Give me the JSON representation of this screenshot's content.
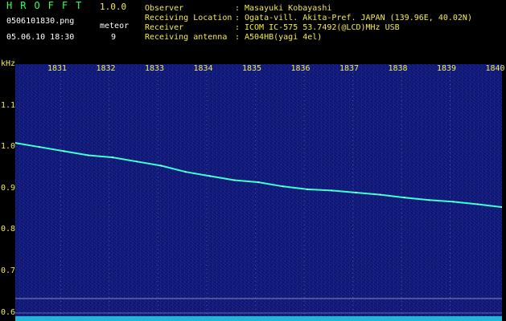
{
  "header": {
    "app_title": "HROFFT",
    "app_version": "1.0.0",
    "file_name": "0506101830.png",
    "meteor_label": "meteor",
    "timestamp": "05.06.10 18:30",
    "meteor_count": "9"
  },
  "info": {
    "rows": [
      {
        "key": "Observer",
        "value": "Masayuki Kobayashi"
      },
      {
        "key": "Receiving Location",
        "value": "Ogata-vill. Akita-Pref. JAPAN (139.96E, 40.02N)"
      },
      {
        "key": "Receiver",
        "value": "ICOM IC-575 53.7492(@LCD)MHz USB"
      },
      {
        "key": "Receiving antenna",
        "value": "A504HB(yagi 4el)"
      }
    ],
    "separator": ":"
  },
  "colors": {
    "background": "#000000",
    "plot_background": "#0d1470",
    "trace": "#3fffd0",
    "label_yellow": "#f4ec4f",
    "title_green": "#35ff5a"
  },
  "chart_data": {
    "type": "line",
    "title": "",
    "ylabel": "kHz",
    "y_unit_label": "kHz",
    "ylim": [
      0.58,
      1.2
    ],
    "xlim": [
      18.3,
      18.4
    ],
    "x_ticks": [
      "1831",
      "1832",
      "1833",
      "1834",
      "1835",
      "1836",
      "1837",
      "1838",
      "1839",
      "1840"
    ],
    "y_ticks": [
      "1.1",
      "1.0",
      "0.9",
      "0.8",
      "0.7",
      "0.6"
    ],
    "series": [
      {
        "x": [
          18.3,
          18.305,
          18.31,
          18.315,
          18.32,
          18.325,
          18.33,
          18.335,
          18.34,
          18.345,
          18.35,
          18.355,
          18.36,
          18.365,
          18.37,
          18.375,
          18.38,
          18.385,
          18.39,
          18.395,
          18.4
        ],
        "y": [
          1.01,
          1.0,
          0.99,
          0.98,
          0.975,
          0.965,
          0.955,
          0.94,
          0.93,
          0.92,
          0.915,
          0.905,
          0.898,
          0.895,
          0.89,
          0.885,
          0.878,
          0.872,
          0.868,
          0.862,
          0.855
        ]
      }
    ]
  }
}
